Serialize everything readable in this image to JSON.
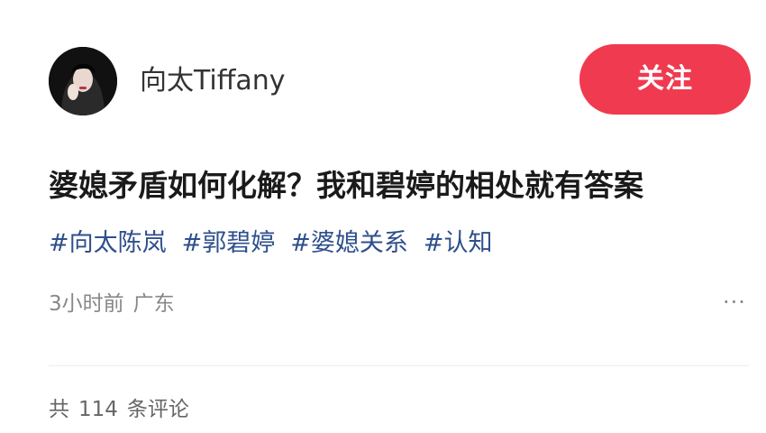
{
  "author": {
    "name": "向太Tiffany",
    "avatar": "profile-photo"
  },
  "follow_label": "关注",
  "post": {
    "title": "婆媳矛盾如何化解？我和碧婷的相处就有答案",
    "tags": [
      "#向太陈岚",
      "#郭碧婷",
      "#婆媳关系",
      "#认知"
    ],
    "time": "3小时前",
    "location": "广东",
    "more_icon": "ellipsis-icon"
  },
  "comments": {
    "prefix": "共",
    "count": "114",
    "suffix": "条评论"
  },
  "colors": {
    "follow_button": "#f03a50",
    "tag": "#2f4f8c",
    "meta": "#888888"
  }
}
